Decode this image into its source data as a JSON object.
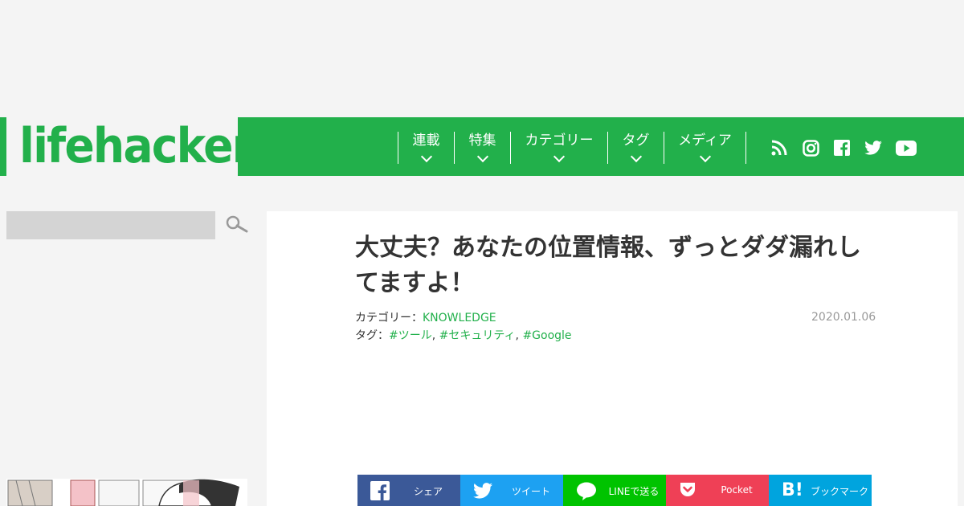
{
  "header": {
    "logo_text": "lifehacker",
    "brand_color": "#22b04b",
    "nav": [
      {
        "label": "連載"
      },
      {
        "label": "特集"
      },
      {
        "label": "カテゴリー"
      },
      {
        "label": "タグ"
      },
      {
        "label": "メディア"
      }
    ],
    "social_icons": [
      "rss-icon",
      "instagram-icon",
      "facebook-icon",
      "twitter-icon",
      "youtube-icon"
    ]
  },
  "search": {
    "placeholder": "",
    "icon": "search-icon"
  },
  "article": {
    "title": "大丈夫？あなたの位置情報、ずっとダダ漏れしてますよ！",
    "category_label": "カテゴリー：",
    "category": "KNOWLEDGE",
    "tags_label": "タグ：",
    "tags": [
      "#ツール",
      "#セキュリティ",
      "#Google"
    ],
    "date": "2020.01.06"
  },
  "share": [
    {
      "label": "シェア",
      "icon": "facebook-icon",
      "color": "#3b5998"
    },
    {
      "label": "ツイート",
      "icon": "twitter-icon",
      "color": "#1da1f2"
    },
    {
      "label": "LINEで送る",
      "icon": "line-icon",
      "color": "#00c300"
    },
    {
      "label": "Pocket",
      "icon": "pocket-icon",
      "color": "#ef4056"
    },
    {
      "label": "ブックマーク",
      "icon": "hatena-bookmark-icon",
      "color": "#00a4de"
    }
  ]
}
